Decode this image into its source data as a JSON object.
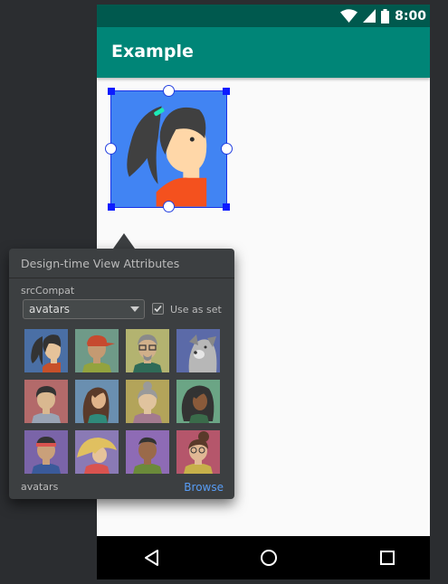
{
  "status_bar": {
    "time": "8:00"
  },
  "app_bar": {
    "title": "Example"
  },
  "popup": {
    "title": "Design-time View Attributes",
    "field_label": "srcCompat",
    "dropdown_value": "avatars",
    "checkbox_label": "Use as set",
    "checkbox_checked": true,
    "footer_name": "avatars",
    "browse_label": "Browse"
  },
  "colors": {
    "status_bar": "#00594e",
    "app_bar": "#008577",
    "image_bg": "#4184f3",
    "selection": "#0c1bff",
    "popup_bg": "#3c3f41",
    "link": "#589df6"
  },
  "avatars": [
    "woman-ponytail-avatar",
    "man-red-cap-avatar",
    "old-man-glasses-avatar",
    "dog-avatar",
    "man-dark-hair-avatar",
    "woman-long-hair-avatar",
    "old-woman-bun-avatar",
    "woman-curly-hair-avatar",
    "man-headband-avatar",
    "woman-blonde-hair-avatar",
    "man-purple-shirt-avatar",
    "woman-glasses-bun-avatar"
  ],
  "icons": {
    "status": [
      "wifi-icon",
      "signal-icon",
      "battery-icon"
    ],
    "nav": [
      "back-icon",
      "home-icon",
      "recents-icon"
    ]
  }
}
